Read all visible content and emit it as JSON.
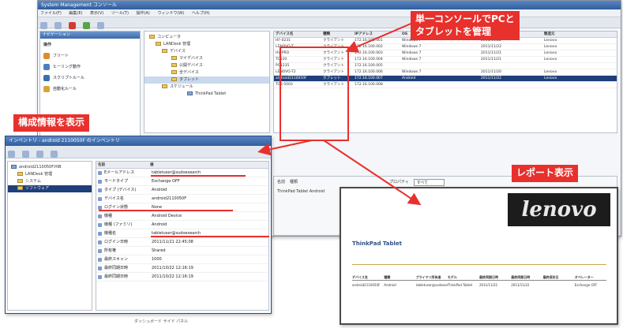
{
  "main_window": {
    "title": "System Management コンソール",
    "menus": [
      "ファイル(F)",
      "編集(E)",
      "表示(V)",
      "ツール(T)",
      "操作(A)",
      "ウィンドウ(W)",
      "ヘルプ(H)"
    ],
    "left_pane_title": "ナビゲーション",
    "nav_section": "操作",
    "nav_items": [
      "フリート",
      "ヒーリング動作",
      "スクリプトルール",
      "自動化ルール"
    ],
    "tree_rows": [
      "コンピュータ",
      "LANDesk 管理",
      "デバイス",
      "マイデバイス",
      "公開デバイス",
      "全デバイス",
      "タブレット",
      "スケジュール",
      "ThinkPad Tablet"
    ],
    "list_headers": [
      "デバイス名",
      "種類",
      "IPアドレス",
      "OS",
      "最終スキャン",
      "製造元"
    ],
    "list_rows": [
      [
        "HF-0231",
        "クライアント",
        "172.16.100.001",
        "Windows 7",
        "2011/11/22",
        "Lenovo"
      ],
      [
        "LENOVO-T",
        "クライアント",
        "172.16.100.002",
        "Windows 7",
        "2011/11/22",
        "Lenovo"
      ],
      [
        "HV-PRO",
        "クライアント",
        "172.16.100.003",
        "Windows 7",
        "2011/11/21",
        "Lenovo"
      ],
      [
        "TC120",
        "クライアント",
        "172.16.100.004",
        "Windows 7",
        "2011/11/21",
        "Lenovo"
      ],
      [
        "PC1235",
        "クライアント",
        "172.16.100.005",
        "",
        "",
        ""
      ],
      [
        "LENOVO-T2",
        "クライアント",
        "172.16.100.006",
        "Windows 7",
        "2011/11/20",
        "Lenovo"
      ],
      [
        "android2110050F",
        "タブレット",
        "172.16.100.007",
        "Android",
        "2011/11/22",
        "Lenovo"
      ],
      [
        "TCB-5003",
        "クライアント",
        "172.16.100.008",
        "",
        "",
        ""
      ]
    ],
    "lower_fields": [
      "名前",
      "種類",
      "プロパティ"
    ],
    "lower_select": "すべて",
    "lower_row": "ThinkPad Tablet Android"
  },
  "inventory_window": {
    "title": "インベントリ - android 2110050F のインベントリ",
    "tree": [
      "android2110050F.HIB",
      "LANDesk 管理",
      "システム",
      "ソフトウェア"
    ],
    "headers": [
      "名前",
      "値"
    ],
    "rows": [
      [
        "Eメールアドレス",
        "tabletuser@sudoesearch"
      ],
      [
        "モードタイプ",
        "Exchange OFF"
      ],
      [
        "タイプ (デバイス)",
        "Android"
      ],
      [
        "デバイス名",
        "android2110050F"
      ],
      [
        "ログイン状態",
        "None"
      ],
      [
        "機種",
        "Android Device"
      ],
      [
        "機種 (ファミリ)",
        "Android"
      ],
      [
        "機種名",
        "tabletuser@sudoesearch"
      ],
      [
        "ログイン日時",
        "2011/11/21 22:45:08"
      ],
      [
        "所有権",
        "Shared"
      ],
      [
        "最終スキャン",
        "1000"
      ],
      [
        "最終同期日時",
        "2011/10/22 12:16:19"
      ],
      [
        "最終同期日時",
        "2011/10/22 12:16:19"
      ]
    ]
  },
  "report_window": {
    "heading": "ThinkPad Tablet",
    "logo": "lenovo",
    "headers": [
      "デバイス名",
      "種類",
      "プライマリ所有者",
      "モデル",
      "最終同期日時",
      "最終同期日時",
      "最終保存日",
      "オペレーター"
    ],
    "row": [
      "android2110050F",
      "Android",
      "tabletuser@sudoesearch",
      "ThinkPad Tablet",
      "2011/11/22",
      "2011/11/22",
      "",
      "Exchange OFF"
    ]
  },
  "bottom_status": "ダッシュボード サイド パネル",
  "callouts": {
    "console": "単一コンソールでPCと\nタブレットを管理",
    "config": "構成情報を表示",
    "report": "レポート表示"
  },
  "colors": {
    "callout": "#e8302d",
    "titlebar": "#2f5e9e",
    "selection": "#1f3f7a"
  }
}
